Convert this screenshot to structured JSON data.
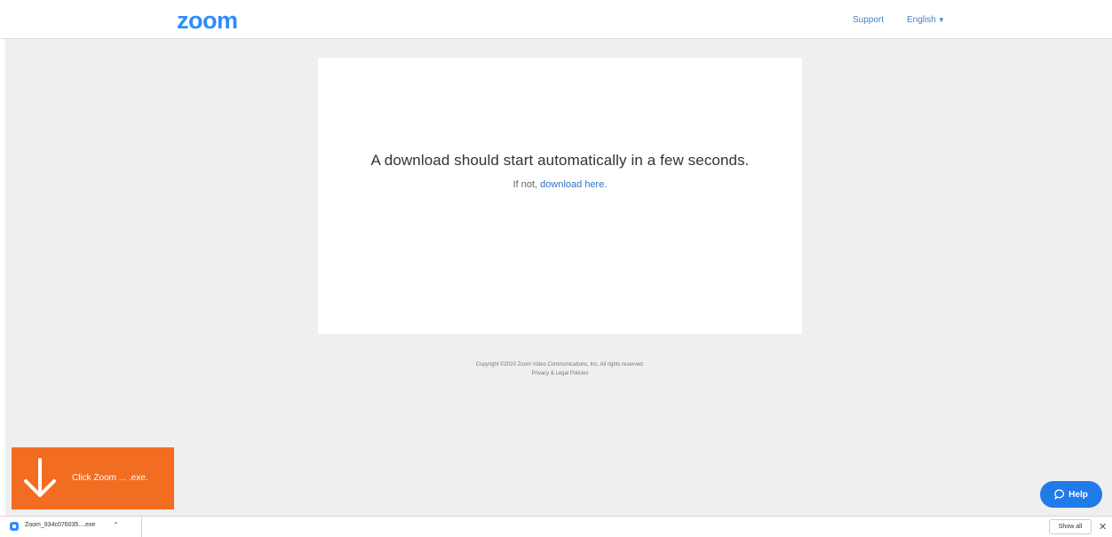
{
  "header": {
    "logo_text": "zoom",
    "support_label": "Support",
    "language_label": "English"
  },
  "card": {
    "message": "A download should start automatically in a few seconds.",
    "fallback_prefix": "If not, ",
    "fallback_link": "download here."
  },
  "footer": {
    "copyright": "Copyright ©2020 Zoom Video Communications, Inc. All rights reserved.",
    "privacy_link": "Privacy & Legal Policies"
  },
  "notification": {
    "text": "Click Zoom ... .exe."
  },
  "help": {
    "label": "Help"
  },
  "download_bar": {
    "file_name": "Zoom_934c076035....exe",
    "show_all_label": "Show all"
  },
  "colors": {
    "brand": "#2D8CFF",
    "notify_orange": "#F26D21",
    "page_bg": "#efefef"
  }
}
